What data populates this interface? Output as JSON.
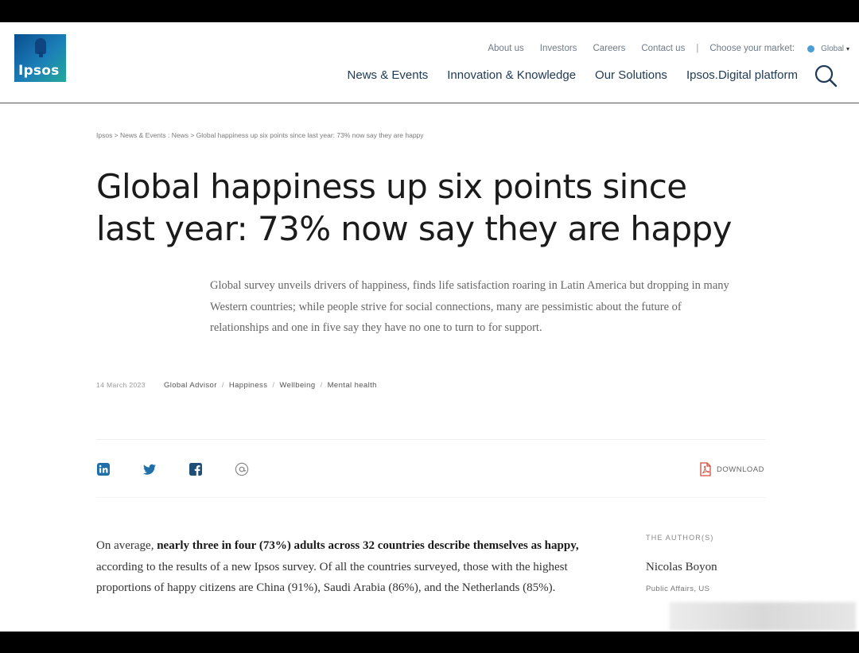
{
  "logo": {
    "text": "Ipsos"
  },
  "utility_nav": {
    "items": [
      "About us",
      "Investors",
      "Careers",
      "Contact us"
    ],
    "separator": "|",
    "market_label": "Choose your market:",
    "market_value": "Global",
    "market_caret": "▾"
  },
  "main_nav": {
    "items": [
      "News & Events",
      "Innovation & Knowledge",
      "Our Solutions",
      "Ipsos.Digital platform"
    ]
  },
  "breadcrumb": "Ipsos > News & Events : News > Global happiness up six points since last year: 73% now say they are happy",
  "article": {
    "title": "Global happiness up six points since last year: 73% now say they are happy",
    "summary": "Global survey unveils drivers of happiness, finds life satisfaction roaring in Latin America but dropping in many Western countries; while people strive for social connections, many are pessimistic about the future of relationships and one in five say they have no one to turn to for support.",
    "date": "14 March 2023",
    "tags": [
      "Global Advisor",
      "Happiness",
      "Wellbeing",
      "Mental health"
    ],
    "tag_separator": "/",
    "download_label": "DOWNLOAD",
    "body": {
      "lead": "On average, ",
      "bold": "nearly three in four (73%) adults across 32 countries describe themselves as happy,",
      "rest": " according to the results of a new Ipsos survey. Of all the countries surveyed, those with the highest proportions of happy citizens are China (91%), Saudi Arabia (86%), and the Netherlands (85%)."
    }
  },
  "share_icons": [
    "linkedin-icon",
    "twitter-icon",
    "facebook-icon",
    "email-icon"
  ],
  "author": {
    "label": "THE AUTHOR(S)",
    "name": "Nicolas Boyon",
    "role": "Public Affairs, US"
  },
  "colors": {
    "nav_text": "#203b55",
    "brand_blue": "#0a4f8f",
    "brand_teal": "#23a99a",
    "share_blue": "#1f6fa8",
    "pdf_red": "#d24a3b"
  }
}
